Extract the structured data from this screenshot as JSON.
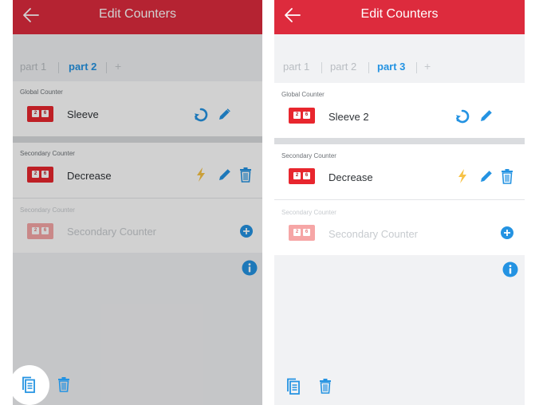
{
  "header": {
    "title": "Edit Counters"
  },
  "left": {
    "tabs": [
      "part 1",
      "part 2"
    ],
    "active_tab": "part 2",
    "add_tab": "+",
    "rows": [
      {
        "label": "Global Counter",
        "name": "Sleeve",
        "digits": [
          "2",
          "6"
        ]
      },
      {
        "label": "Secondary Counter",
        "name": "Decrease",
        "digits": [
          "2",
          "6"
        ]
      },
      {
        "label": "Secondary Counter",
        "name": "Secondary Counter",
        "digits": [
          "2",
          "6"
        ]
      }
    ]
  },
  "right": {
    "tabs": [
      "part 1",
      "part 2",
      "part 3"
    ],
    "active_tab": "part 3",
    "add_tab": "+",
    "rows": [
      {
        "label": "Global Counter",
        "name": "Sleeve 2",
        "digits": [
          "2",
          "6"
        ]
      },
      {
        "label": "Secondary Counter",
        "name": "Decrease",
        "digits": [
          "2",
          "6"
        ]
      },
      {
        "label": "Secondary Counter",
        "name": "Secondary Counter",
        "digits": [
          "2",
          "6"
        ]
      }
    ]
  },
  "icons": {
    "back": "arrow-left-icon",
    "reset": "refresh-icon",
    "edit": "pencil-icon",
    "flash": "lightning-icon",
    "delete": "trash-icon",
    "add": "plus-circle-icon",
    "info": "info-icon",
    "copy": "copy-icon"
  },
  "colors": {
    "header_bg": "#dd2b3d",
    "accent_blue": "#2493e2",
    "flash_yellow": "#f7c245",
    "counter_red": "#e8262e"
  }
}
